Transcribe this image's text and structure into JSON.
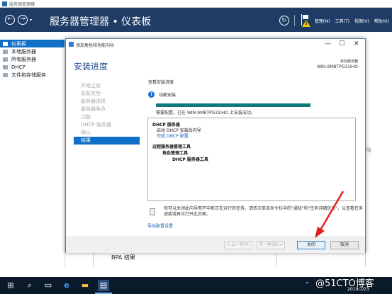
{
  "window": {
    "title": "服务器管理器"
  },
  "header": {
    "breadcrumb": "服务器管理器 • 仪表板",
    "menu": [
      "管理(M)",
      "工具(T)",
      "视图(V)",
      "帮助(H)"
    ]
  },
  "sidebar": {
    "items": [
      {
        "label": "仪表板",
        "active": true
      },
      {
        "label": "本地服务器",
        "active": false
      },
      {
        "label": "所有服务器",
        "active": false
      },
      {
        "label": "DHCP",
        "active": false
      },
      {
        "label": "文件和存储服务",
        "active": false
      }
    ]
  },
  "background": {
    "bpa_label": "BPA 结果",
    "side_text": "隐"
  },
  "dialog": {
    "title": "添加角色和功能向导",
    "heading": "安装进度",
    "target_label": "目标服务器",
    "target_name": "WIN-9MBTPG31IHO",
    "steps": [
      "开始之前",
      "安装类型",
      "服务器选择",
      "服务器角色",
      "功能",
      "DHCP 服务器",
      "确认",
      "结果"
    ],
    "active_step": 7,
    "view_progress": "查看安装进度",
    "feature_install": "功能安装",
    "progress_percent": 100,
    "success_message": "需要配置。已在 WIN-9MBTPG31IHO 上安装成功。",
    "results": {
      "dhcp_server": "DHCP 服务器",
      "launch_wizard": "启动 DHCP 安装后向导",
      "complete_config": "完成 DHCP 配置",
      "remote_tools": "远程服务器管理工具",
      "role_tools": "角色管理工具",
      "dhcp_tools": "DHCP 服务器工具"
    },
    "note": "你可以关闭此向导而不中断正在运行的任务。请依次单击命令栏中的\"通知\"和\"任务详细信息\"，以查看任务进度或再次打开此页面。",
    "export_link": "导出配置设置",
    "buttons": {
      "prev": "< 上一步(P)",
      "next": "下一步(N) >",
      "close": "关闭",
      "cancel": "取消"
    }
  },
  "taskbar": {
    "watermark": "@51CTO博客",
    "date": "2019/7/23"
  }
}
